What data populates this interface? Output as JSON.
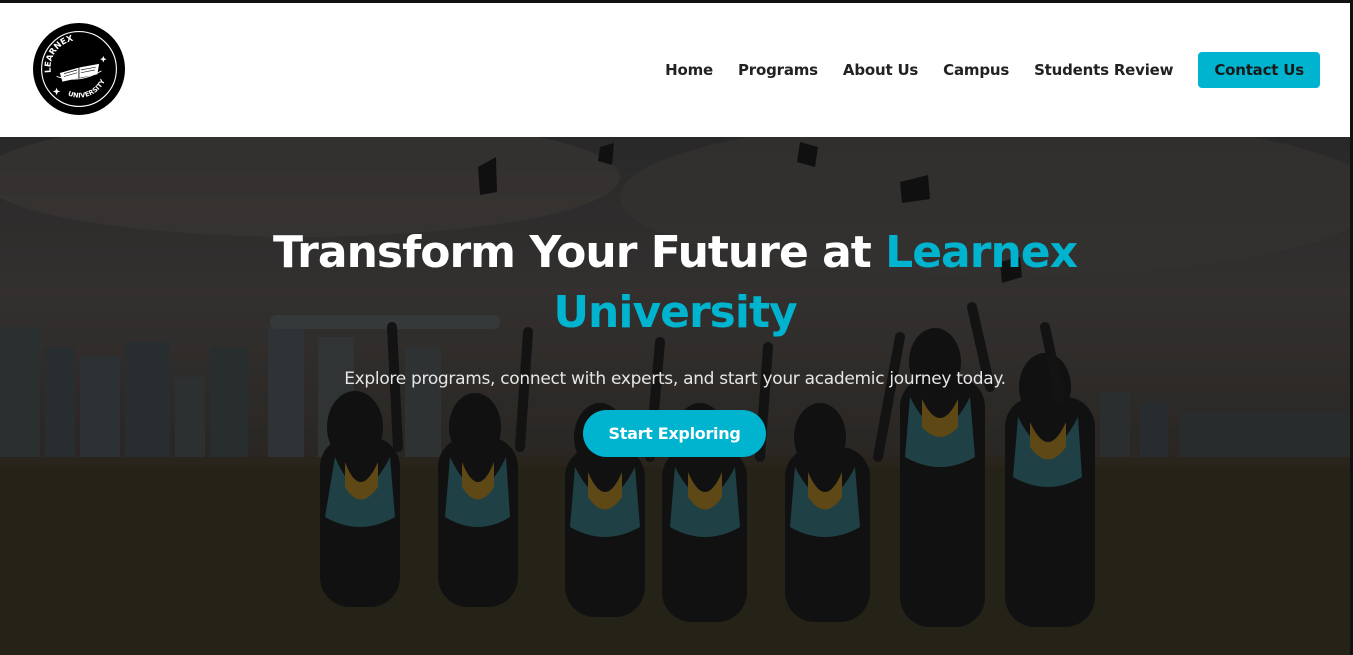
{
  "brand": {
    "logo_top_text": "LEARNEX",
    "logo_bottom_text": "UNIVERSITY"
  },
  "nav": {
    "items": [
      {
        "label": "Home"
      },
      {
        "label": "Programs"
      },
      {
        "label": "About Us"
      },
      {
        "label": "Campus"
      },
      {
        "label": "Students Review"
      }
    ],
    "contact_label": "Contact Us"
  },
  "hero": {
    "title_main": "Transform Your Future at ",
    "title_accent": "Learnex University",
    "subtitle": "Explore programs, connect with experts, and start your academic journey today.",
    "cta_label": "Start Exploring"
  },
  "colors": {
    "accent": "#00b4cf",
    "header_bg": "#ffffff",
    "text_dark": "#222222",
    "hero_text": "#ffffff"
  },
  "icons": [
    "open-book-icon",
    "star-icon"
  ]
}
